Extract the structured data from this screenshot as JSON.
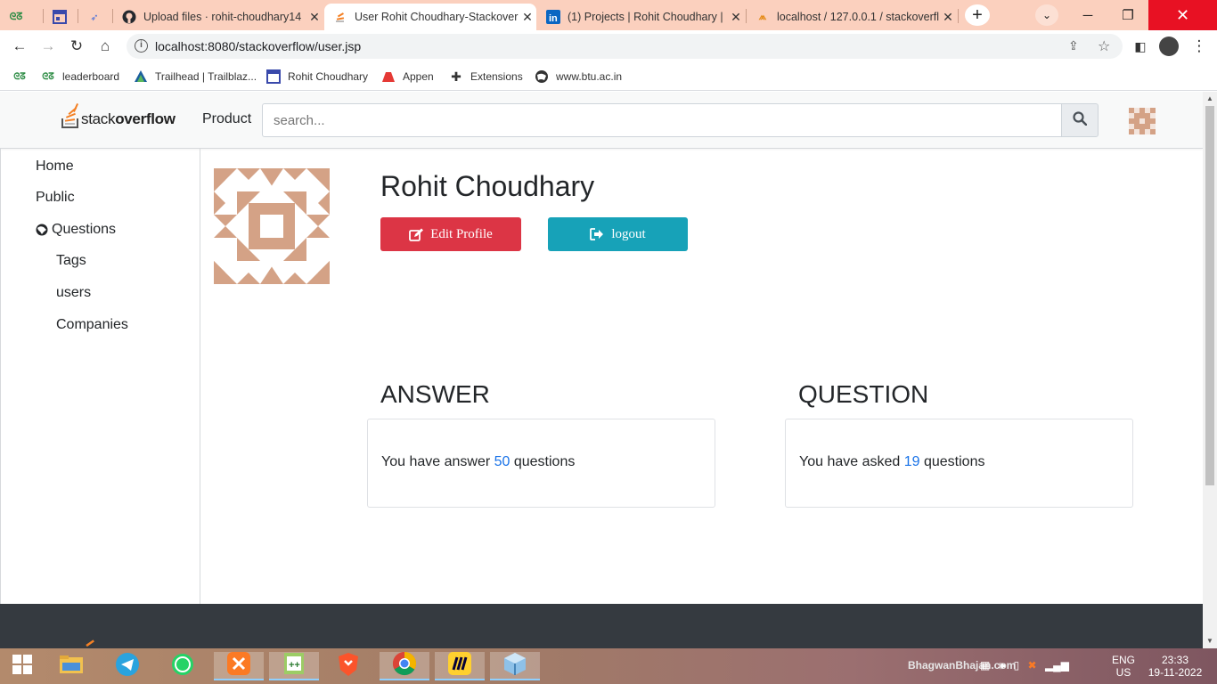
{
  "browser": {
    "tabs": [
      {
        "title": "",
        "icon": "geeksforgeeks-icon"
      },
      {
        "title": "",
        "icon": "calendar-icon"
      },
      {
        "title": "",
        "icon": "rocket-icon"
      },
      {
        "title": "Upload files · rohit-choudhary14",
        "icon": "github-icon"
      },
      {
        "title": "User Rohit Choudhary-Stackover",
        "icon": "stackoverflow-icon"
      },
      {
        "title": "(1) Projects | Rohit Choudhary | L",
        "icon": "linkedin-icon"
      },
      {
        "title": "localhost / 127.0.0.1 / stackoverfl",
        "icon": "phpmyadmin-icon"
      }
    ],
    "new_tab_label": "+",
    "url": "localhost:8080/stackoverflow/user.jsp",
    "bookmarks": [
      {
        "label": "",
        "icon": "geeksforgeeks-icon"
      },
      {
        "label": "leaderboard",
        "icon": "geeksforgeeks-icon"
      },
      {
        "label": "Trailhead | Trailblaz...",
        "icon": "trailhead-icon"
      },
      {
        "label": "Rohit Choudhary",
        "icon": "calendar-icon"
      },
      {
        "label": "Appen",
        "icon": "appen-icon"
      },
      {
        "label": "Extensions",
        "icon": "puzzle-icon"
      },
      {
        "label": "www.btu.ac.in",
        "icon": "globe-icon"
      }
    ]
  },
  "header": {
    "logo_light": "stack",
    "logo_bold": "overflow",
    "product_label": "Product",
    "search_placeholder": "search..."
  },
  "sidebar": {
    "items": [
      {
        "label": "Home"
      },
      {
        "label": "Public"
      },
      {
        "label": "Questions"
      },
      {
        "label": "Tags"
      },
      {
        "label": "users"
      },
      {
        "label": "Companies"
      }
    ]
  },
  "profile": {
    "name": "Rohit Choudhary",
    "edit_label": "Edit Profile",
    "logout_label": "logout"
  },
  "stats": {
    "answer": {
      "title": "ANSWER",
      "prefix": "You have answer ",
      "count": "50",
      "suffix": " questions"
    },
    "question": {
      "title": "QUESTION",
      "prefix": "You have asked ",
      "count": "19",
      "suffix": " questions"
    }
  },
  "taskbar": {
    "apps": [
      "windows-start-icon",
      "file-explorer-icon",
      "telegram-icon",
      "whatsapp-icon",
      "xampp-icon",
      "notepad-plus-plus-icon",
      "brave-icon",
      "chrome-icon",
      "miro-icon",
      "virtualbox-icon"
    ],
    "wallpaper_text": "BhagwanBhajan.com",
    "lang": "ENG",
    "region": "US",
    "time": "23:33",
    "date": "19-11-2022"
  },
  "colors": {
    "avatar": "#d4a286",
    "edit_button": "#dc3545",
    "logout_button": "#17a2b8",
    "link_number": "#1a73e8",
    "footer": "#353a40",
    "tabbar": "#fbd0be"
  }
}
